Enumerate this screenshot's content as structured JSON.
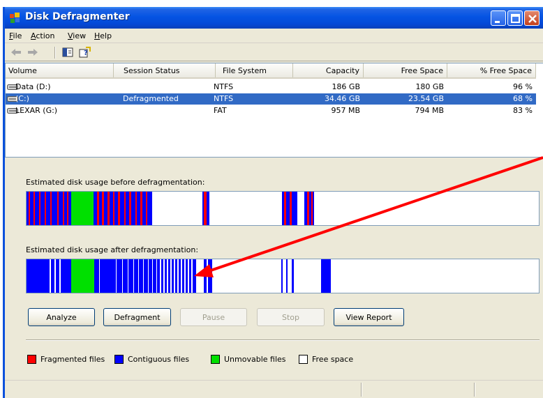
{
  "window": {
    "title": "Disk Defragmenter"
  },
  "menu": [
    {
      "label_u": "F",
      "label_rest": "ile"
    },
    {
      "label_u": "A",
      "label_rest": "ction"
    },
    {
      "label_u": "V",
      "label_rest": "iew"
    },
    {
      "label_u": "H",
      "label_rest": "elp"
    }
  ],
  "toolbar": {
    "icons": [
      "back-arrow-icon",
      "forward-arrow-icon",
      "show-hide-console-tree-icon",
      "help-icon"
    ]
  },
  "volume_list": {
    "columns": [
      "Volume",
      "Session Status",
      "File System",
      "Capacity",
      "Free Space",
      "% Free Space"
    ],
    "rows": [
      {
        "volume": "Data (D:)",
        "status": "",
        "fs": "NTFS",
        "capacity": "186 GB",
        "free": "180 GB",
        "pct": "96 %",
        "selected": false
      },
      {
        "volume": "(C:)",
        "status": "Defragmented",
        "fs": "NTFS",
        "capacity": "34.46 GB",
        "free": "23.54 GB",
        "pct": "68 %",
        "selected": true
      },
      {
        "volume": "LEXAR (G:)",
        "status": "",
        "fs": "FAT",
        "capacity": "957 MB",
        "free": "794 MB",
        "pct": "83 %",
        "selected": false
      }
    ]
  },
  "usage": {
    "before_label": "Estimated disk usage before defragmentation:",
    "after_label": "Estimated disk usage after defragmentation:"
  },
  "buttons": {
    "analyze": "Analyze",
    "defragment": "Defragment",
    "pause": "Pause",
    "stop": "Stop",
    "view_report": "View Report"
  },
  "legend": {
    "fragmented": "Fragmented files",
    "contiguous": "Contiguous files",
    "unmovable": "Unmovable files",
    "free": "Free space"
  },
  "colors": {
    "fragmented": "#ff0000",
    "contiguous": "#0000ff",
    "unmovable": "#00ff00",
    "free": "#ffffff",
    "selection": "#316ac5",
    "annotation_arrow": "#ff0000"
  }
}
